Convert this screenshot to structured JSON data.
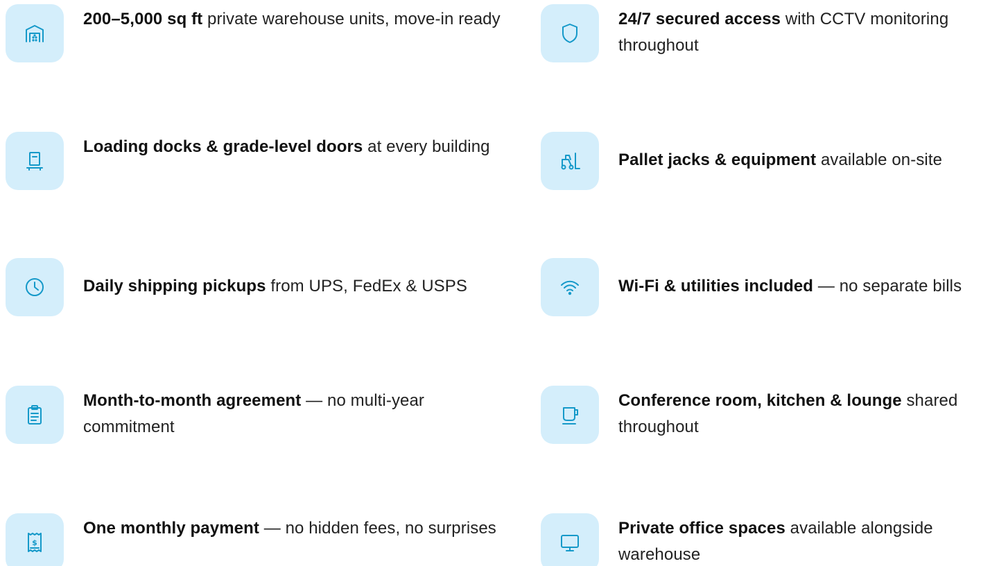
{
  "accent_color": "#1599c9",
  "tile_color": "#d4eefb",
  "features": [
    {
      "icon": "garage-icon",
      "bold": "200–5,000 sq ft",
      "rest": " private warehouse units, move-in ready"
    },
    {
      "icon": "shield-icon",
      "bold": "24/7 secured access",
      "rest": " with CCTV monitoring throughout"
    },
    {
      "icon": "loading-dock-icon",
      "bold": "Loading docks & grade-level doors",
      "rest": " at every building"
    },
    {
      "icon": "forklift-icon",
      "bold": "Pallet jacks & equipment",
      "rest": " available on-site"
    },
    {
      "icon": "clock-icon",
      "bold": "Daily shipping pickups",
      "rest": " from UPS, FedEx & USPS"
    },
    {
      "icon": "wifi-icon",
      "bold": "Wi-Fi & utilities included",
      "rest": " — no separate bills"
    },
    {
      "icon": "clipboard-icon",
      "bold": "Month-to-month agreement",
      "rest": " — no multi-year commitment"
    },
    {
      "icon": "coffee-cup-icon",
      "bold": "Conference room, kitchen & lounge",
      "rest": " shared throughout"
    },
    {
      "icon": "receipt-dollar-icon",
      "bold": "One monthly payment",
      "rest": " — no hidden fees, no surprises"
    },
    {
      "icon": "monitor-icon",
      "bold": "Private office spaces",
      "rest": " available alongside warehouse"
    }
  ]
}
